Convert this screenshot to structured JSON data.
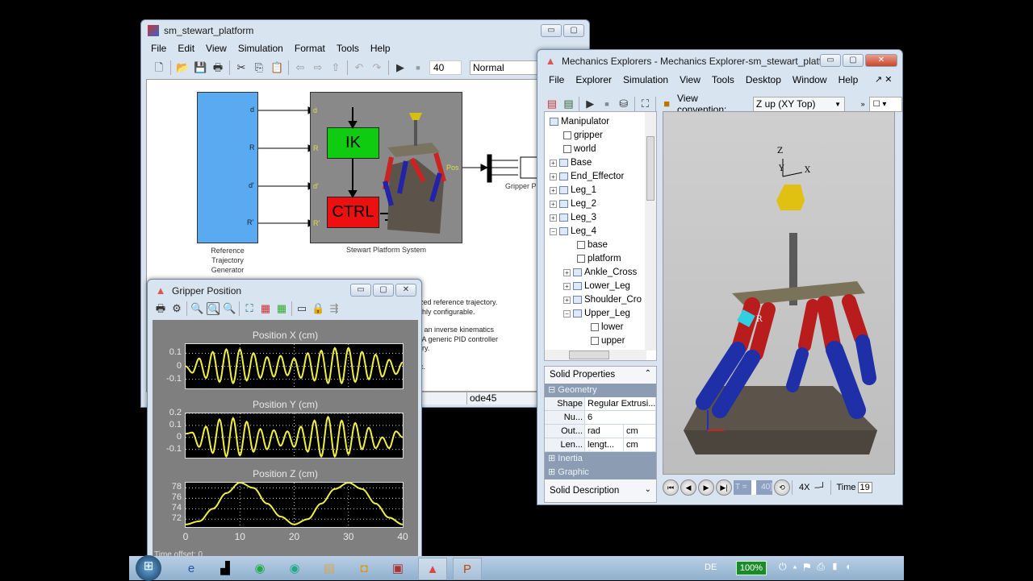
{
  "simulink": {
    "title": "sm_stewart_platform",
    "menu": [
      "File",
      "Edit",
      "View",
      "Simulation",
      "Format",
      "Tools",
      "Help"
    ],
    "stop_time": "40",
    "sim_mode": "Normal",
    "ref_block": {
      "ports": [
        "d",
        "R",
        "d'",
        "R'"
      ],
      "label_lines": [
        "Reference",
        "Trajectory",
        "Generator"
      ]
    },
    "stewart_block": {
      "label": "Stewart Platform System",
      "in_ports": [
        "d",
        "R",
        "d'",
        "R'"
      ],
      "out_port": "Pos",
      "ik": "IK",
      "ctrl": "CTRL"
    },
    "scope_label": "Gripper P",
    "description_lines": [
      "ized reference trajectory.",
      "ghly configurable.",
      "",
      "d an inverse kinematics",
      ".  A generic PID controller",
      "ory.",
      "",
      "ic."
    ],
    "status_solver": "ode45",
    "colors": {
      "ref": "#5aaaf2",
      "stewart": "#898989",
      "ik": "#10cc10",
      "ctrl": "#ee1010"
    }
  },
  "scope": {
    "title": "Gripper Position",
    "time_offset_label": "Time offset:",
    "time_offset": "0",
    "line_color": "#f0f040"
  },
  "chart_data": [
    {
      "type": "line",
      "title": "Position X (cm)",
      "xlim": [
        0,
        40
      ],
      "ylim": [
        -0.17,
        0.17
      ],
      "yticks": [
        "0.1",
        "0",
        "-0.1"
      ],
      "ytick_values": [
        0.1,
        0,
        -0.1
      ],
      "xticks": [],
      "grid": true,
      "x": [
        0,
        1.25,
        2.5,
        3.75,
        5,
        6.25,
        7.5,
        8.75,
        10,
        11.25,
        12.5,
        13.75,
        15,
        16.25,
        17.5,
        18.75,
        20,
        21.25,
        22.5,
        23.75,
        25,
        26.25,
        27.5,
        28.75,
        30,
        31.25,
        32.5,
        33.75,
        35,
        36.25,
        37.5,
        38.75,
        40
      ],
      "y": [
        0.0,
        -0.05,
        0.06,
        -0.09,
        0.11,
        -0.12,
        0.13,
        -0.13,
        0.13,
        -0.11,
        0.1,
        -0.09,
        0.07,
        -0.08,
        0.08,
        -0.07,
        0.06,
        -0.09,
        0.1,
        -0.11,
        0.12,
        -0.13,
        0.14,
        -0.13,
        0.14,
        -0.12,
        0.11,
        -0.1,
        0.09,
        -0.08,
        0.05,
        -0.06,
        0.03
      ]
    },
    {
      "type": "line",
      "title": "Position Y (cm)",
      "xlim": [
        0,
        40
      ],
      "ylim": [
        -0.17,
        0.2
      ],
      "yticks": [
        "0.2",
        "0.1",
        "0",
        "-0.1"
      ],
      "ytick_values": [
        0.2,
        0.1,
        0,
        -0.1
      ],
      "xticks": [],
      "grid": true,
      "x": [
        0,
        1.25,
        2.5,
        3.75,
        5,
        6.25,
        7.5,
        8.75,
        10,
        11.25,
        12.5,
        13.75,
        15,
        16.25,
        17.5,
        18.75,
        20,
        21.25,
        22.5,
        23.75,
        25,
        26.25,
        27.5,
        28.75,
        30,
        31.25,
        32.5,
        33.75,
        35,
        36.25,
        37.5,
        38.75,
        40
      ],
      "y": [
        0.03,
        0.04,
        -0.08,
        0.09,
        -0.13,
        0.15,
        -0.16,
        0.16,
        -0.15,
        0.13,
        -0.12,
        0.07,
        -0.1,
        0.06,
        -0.07,
        0.05,
        -0.08,
        0.09,
        -0.12,
        0.14,
        -0.16,
        0.17,
        -0.16,
        0.14,
        -0.14,
        0.12,
        -0.1,
        0.08,
        -0.09,
        0.0,
        -0.09,
        0.05,
        0.0
      ]
    },
    {
      "type": "line",
      "title": "Position Z (cm)",
      "xlim": [
        0,
        40
      ],
      "ylim": [
        70.5,
        79
      ],
      "yticks": [
        "78",
        "76",
        "74",
        "72"
      ],
      "ytick_values": [
        78,
        76,
        74,
        72
      ],
      "xticks": [
        "0",
        "10",
        "20",
        "30",
        "40"
      ],
      "grid": true,
      "x": [
        0,
        2.5,
        5,
        7.5,
        10,
        12.5,
        15,
        17.5,
        20,
        22.5,
        25,
        27.5,
        30,
        32.5,
        35,
        37.5,
        40
      ],
      "y": [
        71,
        71.6,
        74,
        77,
        79,
        78,
        75,
        72.5,
        71,
        72,
        75,
        77.8,
        79,
        77.8,
        75,
        72.3,
        71
      ]
    }
  ],
  "explorer": {
    "title": "Mechanics Explorers - Mechanics Explorer-sm_stewart_platform",
    "menu": [
      "File",
      "Explorer",
      "Simulation",
      "View",
      "Tools",
      "Desktop",
      "Window",
      "Help"
    ],
    "view_convention_label": "View convention:",
    "view_convention": "Z up (XY Top)",
    "tree": [
      {
        "label": "Manipulator",
        "level": 0,
        "kind": "node",
        "exp": ""
      },
      {
        "label": "gripper",
        "level": 1,
        "kind": "leaf",
        "exp": ""
      },
      {
        "label": "world",
        "level": 1,
        "kind": "leaf",
        "exp": ""
      },
      {
        "label": "Base",
        "level": 0,
        "kind": "node",
        "exp": "+"
      },
      {
        "label": "End_Effector",
        "level": 0,
        "kind": "node",
        "exp": "+"
      },
      {
        "label": "Leg_1",
        "level": 0,
        "kind": "node",
        "exp": "+"
      },
      {
        "label": "Leg_2",
        "level": 0,
        "kind": "node",
        "exp": "+"
      },
      {
        "label": "Leg_3",
        "level": 0,
        "kind": "node",
        "exp": "+"
      },
      {
        "label": "Leg_4",
        "level": 0,
        "kind": "node",
        "exp": "-"
      },
      {
        "label": "base",
        "level": 2,
        "kind": "leaf",
        "exp": ""
      },
      {
        "label": "platform",
        "level": 2,
        "kind": "leaf",
        "exp": ""
      },
      {
        "label": "Ankle_Cross",
        "level": 1,
        "kind": "node",
        "exp": "+"
      },
      {
        "label": "Lower_Leg",
        "level": 1,
        "kind": "node",
        "exp": "+"
      },
      {
        "label": "Shoulder_Cro",
        "level": 1,
        "kind": "node",
        "exp": "+"
      },
      {
        "label": "Upper_Leg",
        "level": 1,
        "kind": "node",
        "exp": "-"
      },
      {
        "label": "lower",
        "level": 3,
        "kind": "leaf",
        "exp": ""
      },
      {
        "label": "upper",
        "level": 3,
        "kind": "leaf",
        "exp": ""
      }
    ],
    "props": {
      "header": "Solid Properties",
      "geometry": "Geometry",
      "rows": [
        [
          "Shape",
          "Regular Extrusi...",
          ""
        ],
        [
          "Nu...",
          "6",
          ""
        ],
        [
          "Out...",
          "rad",
          "cm"
        ],
        [
          "Len...",
          "lengt...",
          "cm"
        ]
      ],
      "inertia": "Inertia",
      "graphic": "Graphic",
      "description": "Solid Description"
    },
    "axes_labels": {
      "z": "Z",
      "y": "Y",
      "x": "X",
      "r": "R"
    },
    "playback": {
      "t_label": "T =",
      "t_value": "40]",
      "speed": "4X",
      "time_label": "Time",
      "time_value": "19"
    }
  },
  "taskbar": {
    "lang": "DE",
    "battery": "100%"
  }
}
